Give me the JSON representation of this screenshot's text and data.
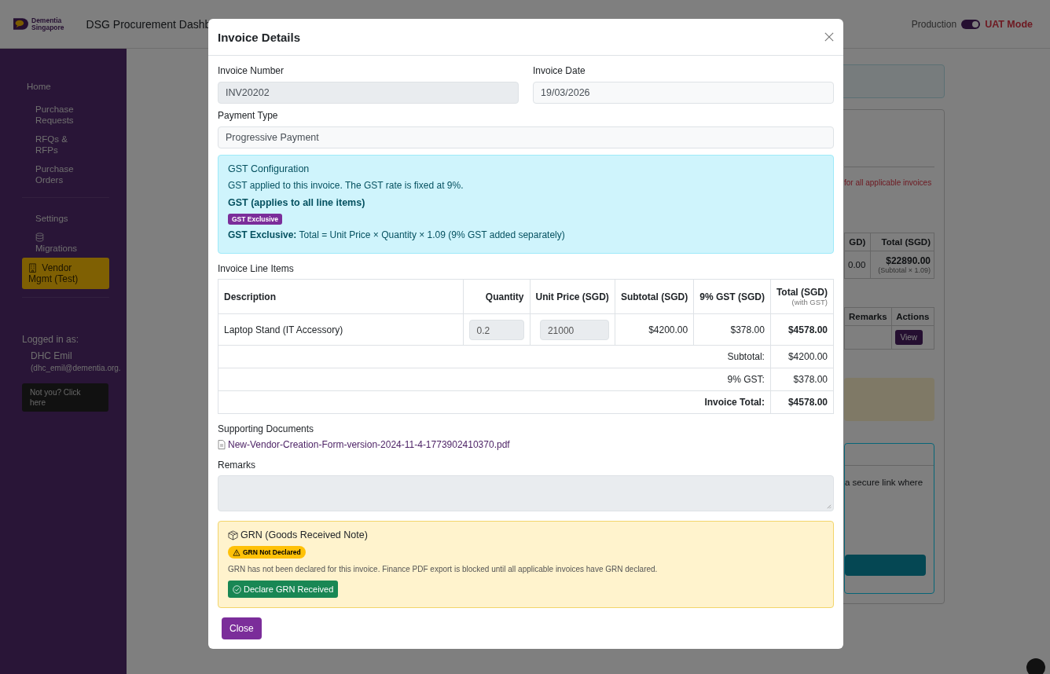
{
  "app_header": {
    "logo_lines": [
      "Dementia",
      "Singapore"
    ],
    "title": "DSG Procurement Dashb",
    "mode_switch": {
      "left_label": "Production",
      "on": true,
      "right_label": "UAT Mode"
    }
  },
  "sidebar": {
    "groups": [
      [
        {
          "label": "Home",
          "kind": "heading",
          "selected": false
        },
        {
          "label": "Purchase Requests",
          "kind": "link",
          "selected": false
        },
        {
          "label": "RFQs & RFPs",
          "kind": "link",
          "selected": false
        },
        {
          "label": "Purchase Orders",
          "kind": "link",
          "selected": false
        }
      ],
      [
        {
          "label": "Settings",
          "kind": "link",
          "selected": false
        },
        {
          "label": "Migrations",
          "kind": "database",
          "selected": false
        },
        {
          "label": "Vendor Mgmt (Test)",
          "kind": "building",
          "selected": true
        }
      ]
    ],
    "logged_in_label": "Logged in as:",
    "user_name": "DHC Emil",
    "user_email": "(dhc_emil@dementia.org.",
    "logout_button": "Not you? Click here"
  },
  "background_page": {
    "notice": "for all applicable invoices",
    "summary_table": {
      "columns": [
        "GD)",
        "Total (SGD)"
      ],
      "cells": [
        "0.00",
        "$22890.00"
      ],
      "total_note": "(Subtotal × 1.09)"
    },
    "invoices_table": {
      "columns": [
        "Remarks",
        "Actions"
      ],
      "action_button": "View"
    },
    "link_card_text": "a secure link where"
  },
  "modal": {
    "title": "Invoice Details",
    "fields": [
      {
        "label": "Invoice Number",
        "value": "INV20202",
        "disabled": true
      },
      {
        "label": "Invoice Date",
        "value": "19/03/2026",
        "disabled": false
      },
      {
        "label": "Payment Type",
        "value": "Progressive Payment",
        "disabled": false
      }
    ],
    "gst": {
      "title": "GST Configuration",
      "text": "GST applied to this invoice. The GST rate is fixed at 9%.",
      "subheading": "GST (applies to all line items)",
      "badge": "GST Exclusive",
      "formula": "**GST Exclusive:** Total = Unit Price × Quantity × 1.09 (9% GST added separately)"
    },
    "line_items": {
      "label": "Invoice Line Items",
      "columns": [
        {
          "label": "Description"
        },
        {
          "label": "Quantity"
        },
        {
          "label": "Unit Price (SGD)"
        },
        {
          "label": "Subtotal (SGD)"
        },
        {
          "label": "9% GST (SGD)"
        },
        {
          "label": "Total (SGD)",
          "note": "(with GST)"
        }
      ],
      "rows": [
        {
          "description": "Laptop Stand (IT Accessory)",
          "quantity": "0.2",
          "unit_price": "21000",
          "subtotal": "$4200.00",
          "gst": "$378.00",
          "total": "$4578.00"
        }
      ],
      "summary": [
        {
          "label": "Subtotal:",
          "value": "$4200.00",
          "bold": false
        },
        {
          "label": "9% GST:",
          "value": "$378.00",
          "bold": false
        },
        {
          "label": "Invoice Total:",
          "value": "$4578.00",
          "bold": true
        }
      ]
    },
    "documents": {
      "label": "Supporting Documents",
      "files": [
        "New-Vendor-Creation-Form-version-2024-11-4-1773902410370.pdf"
      ]
    },
    "remarks": {
      "label": "Remarks"
    },
    "grn": {
      "title": "GRN (Goods Received Note)",
      "badge": "GRN Not Declared",
      "declared": false,
      "text": "GRN has not been declared for this invoice. Finance PDF export is blocked until all applicable invoices have GRN declared.",
      "button": "Declare GRN Received"
    },
    "close_button": "Close"
  }
}
